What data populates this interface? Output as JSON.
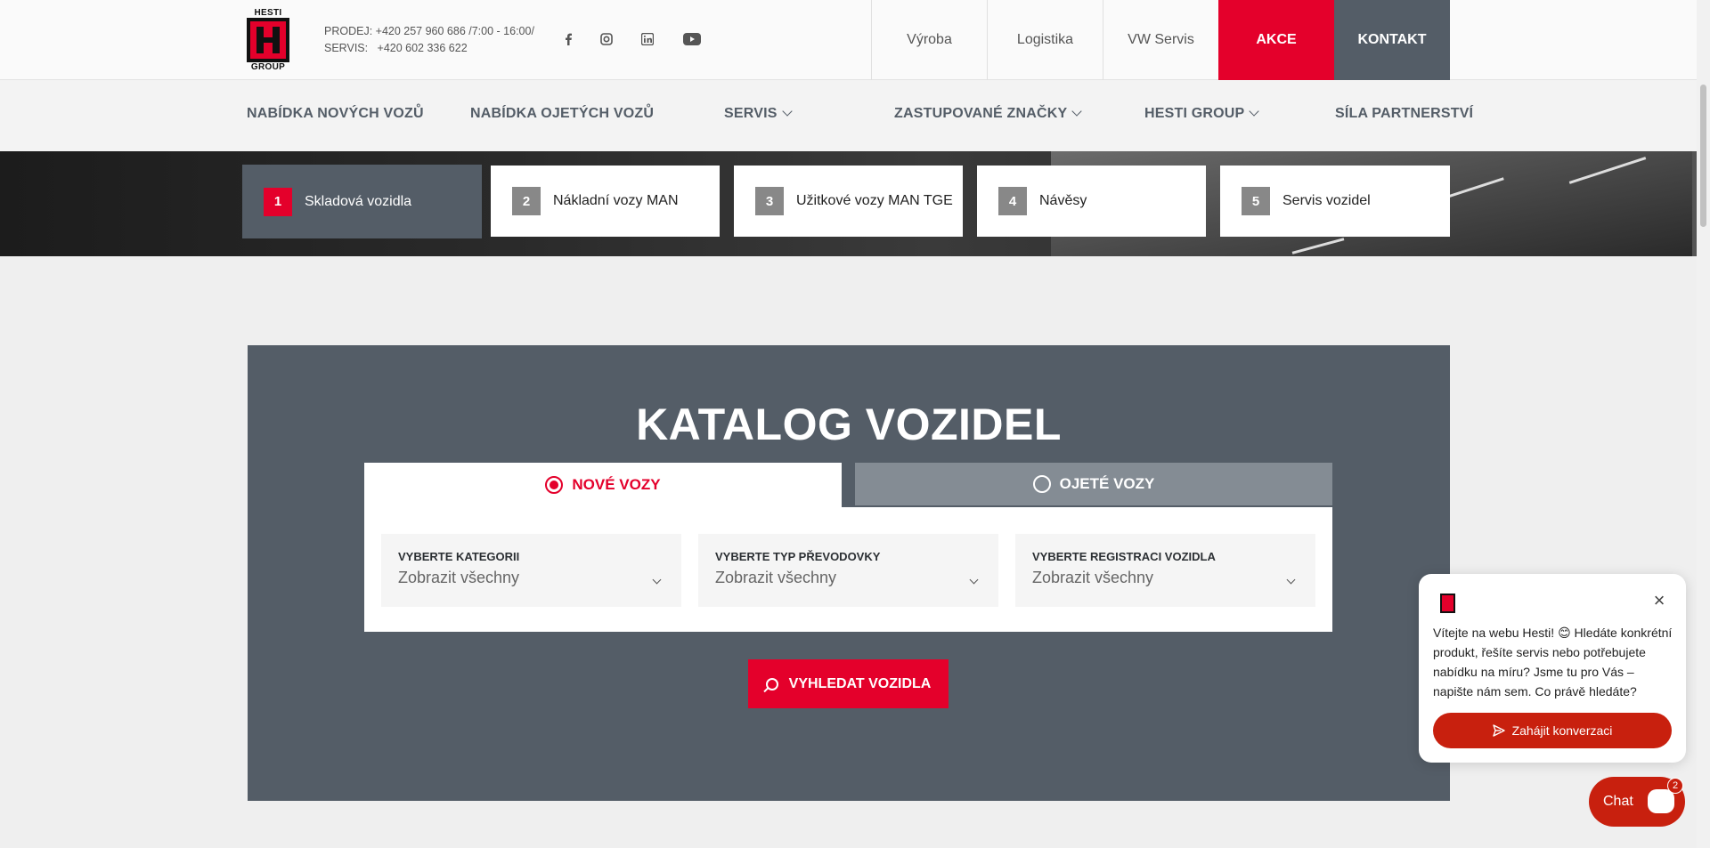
{
  "logo": {
    "top": "HESTI",
    "bottom": "GROUP"
  },
  "contacts": {
    "line1": "PRODEJ: +420 257 960 686 /7:00 - 16:00/",
    "line2": "SERVIS:   +420 602 336 622"
  },
  "social": [
    "facebook-icon",
    "instagram-icon",
    "linkedin-icon",
    "youtube-icon"
  ],
  "topnav": {
    "vyroba": "Výroba",
    "logistika": "Logistika",
    "vw_servis": "VW Servis",
    "akce": "AKCE",
    "kontakt": "KONTAKT"
  },
  "mainnav": {
    "new_cars": "NABÍDKA NOVÝCH VOZŮ",
    "used_cars": "NABÍDKA OJETÝCH VOZŮ",
    "servis": "SERVIS",
    "brands": "ZASTUPOVANÉ ZNAČKY",
    "hesti_group": "HESTI GROUP",
    "partnership": "SÍLA PARTNERSTVÍ"
  },
  "steps": [
    {
      "num": "1",
      "label": "Skladová vozidla"
    },
    {
      "num": "2",
      "label": "Nákladní vozy MAN"
    },
    {
      "num": "3",
      "label": "Užitkové vozy MAN TGE"
    },
    {
      "num": "4",
      "label": "Návěsy"
    },
    {
      "num": "5",
      "label": "Servis vozidel"
    }
  ],
  "catalog": {
    "title": "KATALOG VOZIDEL",
    "tab_new": "NOVÉ VOZY",
    "tab_used": "OJETÉ VOZY",
    "filters": [
      {
        "label": "VYBERTE KATEGORII",
        "value": "Zobrazit všechny"
      },
      {
        "label": "VYBERTE TYP PŘEVODOVKY",
        "value": "Zobrazit všechny"
      },
      {
        "label": "VYBERTE REGISTRACI VOZIDLA",
        "value": "Zobrazit všechny"
      }
    ],
    "search_button": "VYHLEDAT VOZIDLA"
  },
  "chat": {
    "message": "Vítejte na webu Hesti! 😊 Hledáte konkrétní produkt, řešíte servis nebo potřebujete nabídku na míru? Jsme tu pro Vás – napište nám sem. Co právě hledáte?",
    "cta": "Zahájit konverzaci",
    "button": "Chat",
    "badge": "2"
  },
  "colors": {
    "brand_red": "#e4002b",
    "slate": "#545d67",
    "chat_red": "#c8200e"
  }
}
